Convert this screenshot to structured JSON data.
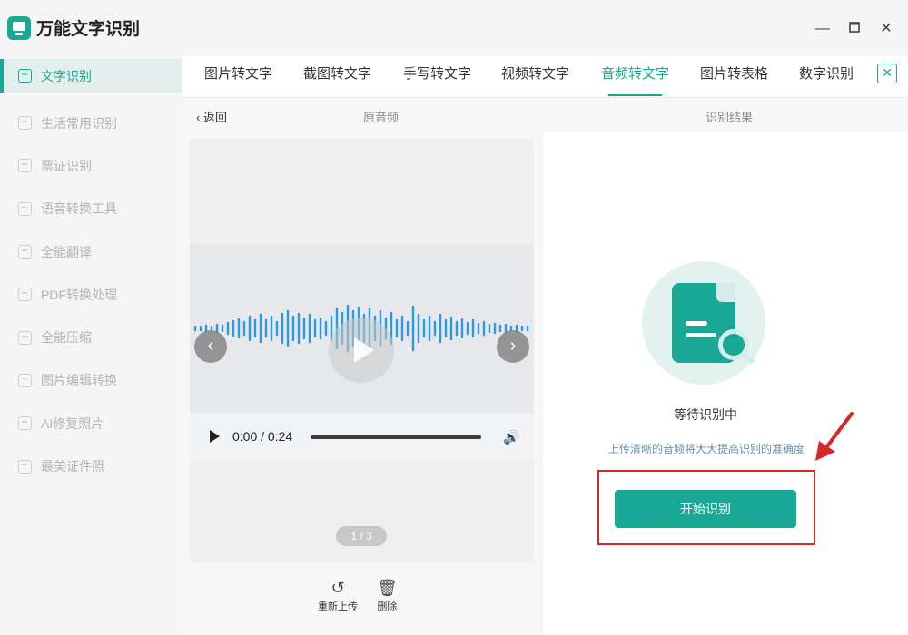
{
  "app": {
    "title": "万能文字识别"
  },
  "sidebar": {
    "items": [
      {
        "label": "文字识别",
        "active": true
      },
      {
        "label": "生活常用识别"
      },
      {
        "label": "票证识别"
      },
      {
        "label": "语音转换工具"
      },
      {
        "label": "全能翻译"
      },
      {
        "label": "PDF转换处理"
      },
      {
        "label": "全能压缩"
      },
      {
        "label": "图片编辑转换"
      },
      {
        "label": "AI修复照片"
      },
      {
        "label": "最美证件照"
      }
    ]
  },
  "tabs": [
    {
      "label": "图片转文字"
    },
    {
      "label": "截图转文字"
    },
    {
      "label": "手写转文字"
    },
    {
      "label": "视频转文字"
    },
    {
      "label": "音频转文字",
      "active": true
    },
    {
      "label": "图片转表格"
    },
    {
      "label": "数字识别"
    }
  ],
  "subheader": {
    "back_label": "返回",
    "left_title": "原音频",
    "right_title": "识别结果"
  },
  "player": {
    "time": "0:00 / 0:24",
    "pager": "1 / 3"
  },
  "actions": {
    "reupload": "重新上传",
    "delete": "删除"
  },
  "result": {
    "status": "等待识别中",
    "hint": "上传清晰的音频将大大提高识别的准确度",
    "start_button": "开始识别"
  },
  "colors": {
    "accent": "#1aa896",
    "highlight": "#d62828"
  }
}
